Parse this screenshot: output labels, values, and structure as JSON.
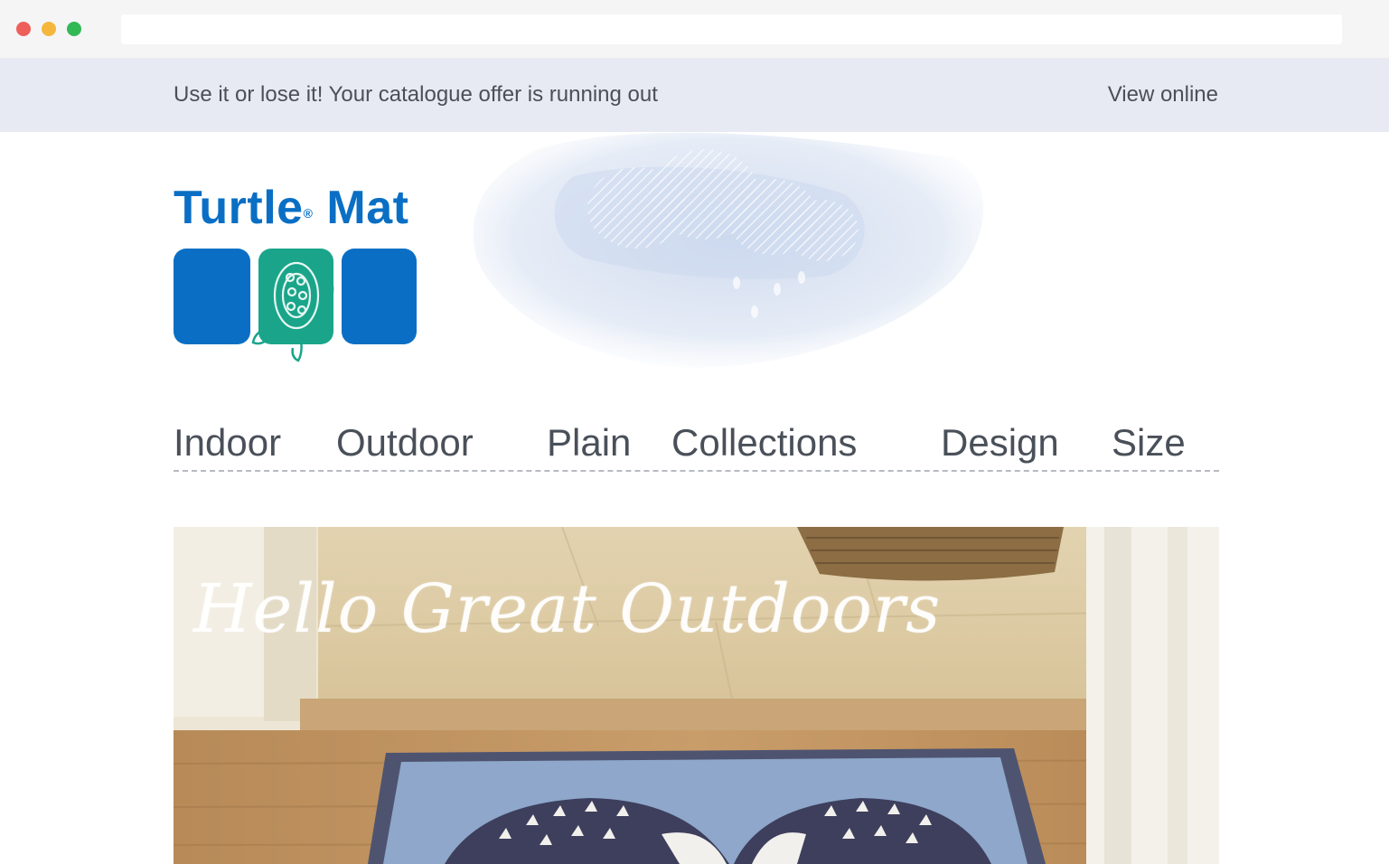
{
  "preheader": {
    "message": "Use it or lose it! Your catalogue offer is running out",
    "view_online": "View online"
  },
  "logo": {
    "word": "Turtle",
    "registered": "®",
    "word2": "Mat",
    "brand_color": "#0a6fc4",
    "accent_color": "#1aa58a"
  },
  "nav": {
    "items": [
      "Indoor",
      "Outdoor",
      "Plain",
      "Collections",
      "Design",
      "Size"
    ]
  },
  "hero": {
    "headline": "Hello Great Outdoors"
  }
}
